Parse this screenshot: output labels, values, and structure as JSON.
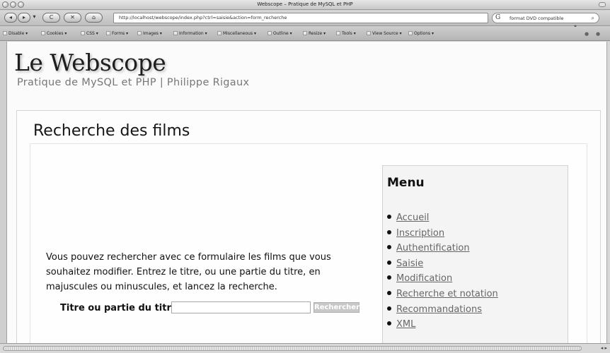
{
  "window": {
    "title": "Webscope – Pratique de MySQL et PHP"
  },
  "navbar": {
    "back_label": "◂",
    "forward_label": "▸",
    "reload_label": "C",
    "stop_label": "✕",
    "home_label": "⌂",
    "url": "http://localhost/webscope/index.php?ctrl=saisie&action=form_recherche",
    "star_label": "☆ ▾",
    "search_engine_label": "G",
    "search_value": "format DVD compatible",
    "search_icon": "⌕"
  },
  "devbar": {
    "items": [
      "Disable ▾",
      "Cookies ▾",
      "CSS ▾",
      "Forms ▾",
      "Images ▾",
      "Information ▾",
      "Miscellaneous ▾",
      "Outline ▾",
      "Resize ▾",
      "Tools ▾",
      "View Source ▾",
      "Options ▾"
    ]
  },
  "site": {
    "logo": "Le Webscope",
    "subtitle": "Pratique de MySQL et PHP | Philippe Rigaux"
  },
  "main": {
    "page_title": "Recherche des films",
    "intro": "Vous pouvez rechercher avec ce formulaire les films que vous souhaitez modifier. Entrez le titre, ou une partie du titre, en majuscules ou minuscules, et lancez la recherche.",
    "form_label": "Titre ou partie du titre",
    "title_input_value": "",
    "search_button_label": "Rechercher"
  },
  "menu": {
    "title": "Menu",
    "items": [
      "Accueil",
      "Inscription",
      "Authentification",
      "Saisie",
      "Modification",
      "Recherche et notation",
      "Recommandations",
      "XML"
    ]
  }
}
